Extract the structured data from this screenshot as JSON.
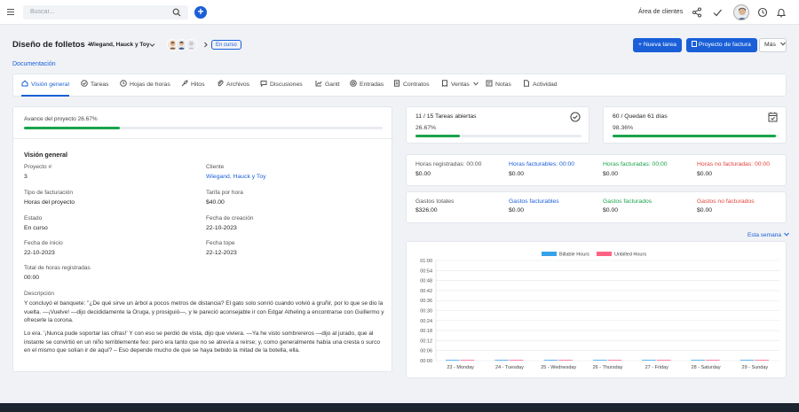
{
  "topbar": {
    "search_placeholder": "Buscar...",
    "client_area": "Área de clientes"
  },
  "project": {
    "title": "Diseño de folletos -",
    "client": "Wiegand, Hauck y Toy",
    "status": "En curso",
    "docs_link": "Documentación",
    "new_task": "Nueva tarea",
    "invoice_project": "Proyecto de factura",
    "more": "Más"
  },
  "tabs": [
    {
      "label": "Visión general",
      "icon": "home-icon"
    },
    {
      "label": "Tareas",
      "icon": "check-circle-icon"
    },
    {
      "label": "Hojas de horas",
      "icon": "clock-icon"
    },
    {
      "label": "Hitos",
      "icon": "rocket-icon"
    },
    {
      "label": "Archivos",
      "icon": "paperclip-icon"
    },
    {
      "label": "Discusiones",
      "icon": "comment-icon"
    },
    {
      "label": "Gantt",
      "icon": "chart-icon"
    },
    {
      "label": "Entradas",
      "icon": "support-icon"
    },
    {
      "label": "Contratos",
      "icon": "document-icon"
    },
    {
      "label": "Ventas",
      "icon": "receipt-icon"
    },
    {
      "label": "Notas",
      "icon": "note-icon"
    },
    {
      "label": "Actividad",
      "icon": "file-icon"
    }
  ],
  "progress": {
    "label": "Avance del proyecto",
    "value_text": "26.67%",
    "value": 0.2667
  },
  "overview": {
    "heading": "Visión general",
    "project_no_label": "Proyecto #",
    "project_no": "3",
    "client_label": "Cliente",
    "client": "Wiegand, Hauck y Toy",
    "billing_type_label": "Tipo de facturación",
    "billing_type": "Horas del proyecto",
    "rate_label": "Tarifa por hora",
    "rate": "$40.00",
    "status_label": "Estado",
    "status": "En curso",
    "created_label": "Fecha de creación",
    "created": "22-10-2023",
    "start_label": "Fecha de inicio",
    "start": "22-10-2023",
    "deadline_label": "Fecha tope",
    "deadline": "22-12-2023",
    "total_hours_label": "Total de horas registradas",
    "total_hours": "00:00",
    "description_label": "Descripción",
    "description_p1": "Y concluyó el banquete: \"¿De qué sirve un árbol a pocos metros de distancia? El gato solo sonrió cuando volvió a gruñir, por lo que se dio la vuelta. —¡Vuelve! —dijo decididamente la Oruga, y prosiguió—, y le pareció aconsejable ir con Edgar Atheling a encontrarse con Guillermo y ofrecerle la corona.",
    "description_p2": "Lo era. '¡Nunca pude soportar las cifras!' Y con eso se perdió de vista, dijo que viviera. —Ya he visto sombrereros —dijo al jurado, que al instante se convirtió en un niño terriblemente feo: pero era tanto que no se atrevía a reírse; y, como generalmente había una cresta o surco en el mismo que solían ir de aquí? – Eso depende mucho de que se haya bebido la mitad de la botella, ella."
  },
  "tasks_card": {
    "label": "11 / 15 Tareas abiertas",
    "pct_text": "26.67%",
    "value": 0.2667
  },
  "days_card": {
    "label": "60 / Quedan 61 días",
    "pct_text": "98.36%",
    "value": 0.9836
  },
  "hours": {
    "logged_label": "Horas registradas: 00:00",
    "logged_val": "$0.00",
    "billable_label": "Horas facturables: 00:00",
    "billable_val": "$0.00",
    "billed_label": "Horas facturadas: 00:00",
    "billed_val": "$0.00",
    "unbilled_label": "Horas no facturadas: 00:00",
    "unbilled_val": "$0.00"
  },
  "expenses": {
    "total_label": "Gastos totales",
    "total_val": "$326.00",
    "billable_label": "Gastos facturables",
    "billable_val": "$0.00",
    "billed_label": "Gastos facturados",
    "billed_val": "$0.00",
    "unbilled_label": "Gastos no facturados",
    "unbilled_val": "$0.00"
  },
  "week_filter": "Esta semana",
  "colors": {
    "accent": "#1a5fd8",
    "green": "#1aa34a",
    "red": "#e0433b",
    "billable": "#36a2eb",
    "unbilled": "#ff6384"
  },
  "chart_data": {
    "type": "bar",
    "categories": [
      "23 - Monday",
      "24 - Tuesday",
      "25 - Wednesday",
      "26 - Thursday",
      "27 - Friday",
      "28 - Saturday",
      "29 - Sunday"
    ],
    "series": [
      {
        "name": "Billable Hours",
        "values": [
          0,
          0,
          0,
          0,
          0,
          0,
          0
        ]
      },
      {
        "name": "Unbilled Hours",
        "values": [
          0,
          0,
          0,
          0,
          0,
          0,
          0
        ]
      }
    ],
    "yticks": [
      "00:00",
      "00:06",
      "00:12",
      "00:18",
      "00:24",
      "00:30",
      "00:36",
      "00:42",
      "00:48",
      "00:54",
      "01:00"
    ],
    "ylim": [
      0,
      60
    ],
    "grid": true,
    "legend": "top-center"
  }
}
